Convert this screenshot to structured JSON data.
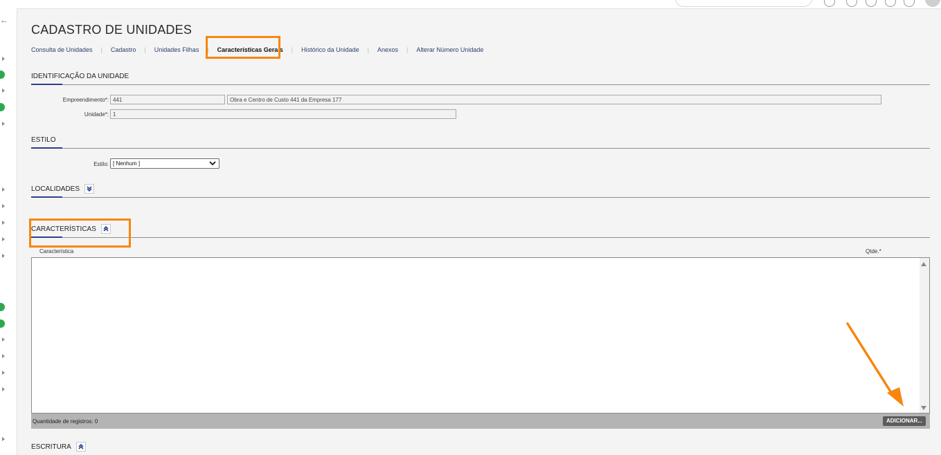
{
  "page": {
    "title": "CADASTRO DE UNIDADES"
  },
  "tabs": [
    {
      "label": "Consulta de Unidades"
    },
    {
      "label": "Cadastro"
    },
    {
      "label": "Unidades Filhas"
    },
    {
      "label": "Características Gerais",
      "active": true
    },
    {
      "label": "Histórico da Unidade"
    },
    {
      "label": "Anexos"
    },
    {
      "label": "Alterar Número Unidade"
    }
  ],
  "identificacao": {
    "title": "IDENTIFICAÇÃO DA UNIDADE",
    "empreendimento_label": "Empreendimento*:",
    "empreendimento_code": "441",
    "empreendimento_desc": "Obra e Centro de Custo 441 da Empresa 177",
    "unidade_label": "Unidade*:",
    "unidade_value": "1"
  },
  "estilo": {
    "title": "ESTILO",
    "label": "Estilo:",
    "selected": "[ Nenhum ]"
  },
  "localidades": {
    "title": "LOCALIDADES",
    "icon": "double-chevron-down-icon"
  },
  "caracteristicas": {
    "title": "CARACTERÍSTICAS",
    "icon": "double-chevron-up-icon",
    "columns": {
      "caracteristica": "Característica",
      "qtde": "Qtde.*"
    },
    "rows": [],
    "count_text": "Quantidade de registros: 0",
    "add_button": "ADICIONAR..."
  },
  "escritura": {
    "title": "ESCRITURA",
    "icon": "double-chevron-up-icon"
  },
  "colors": {
    "highlight": "#f7860d",
    "accent_underline": "#2b3f8f",
    "link": "#2b3f6b",
    "status_green": "#2fa84f"
  }
}
